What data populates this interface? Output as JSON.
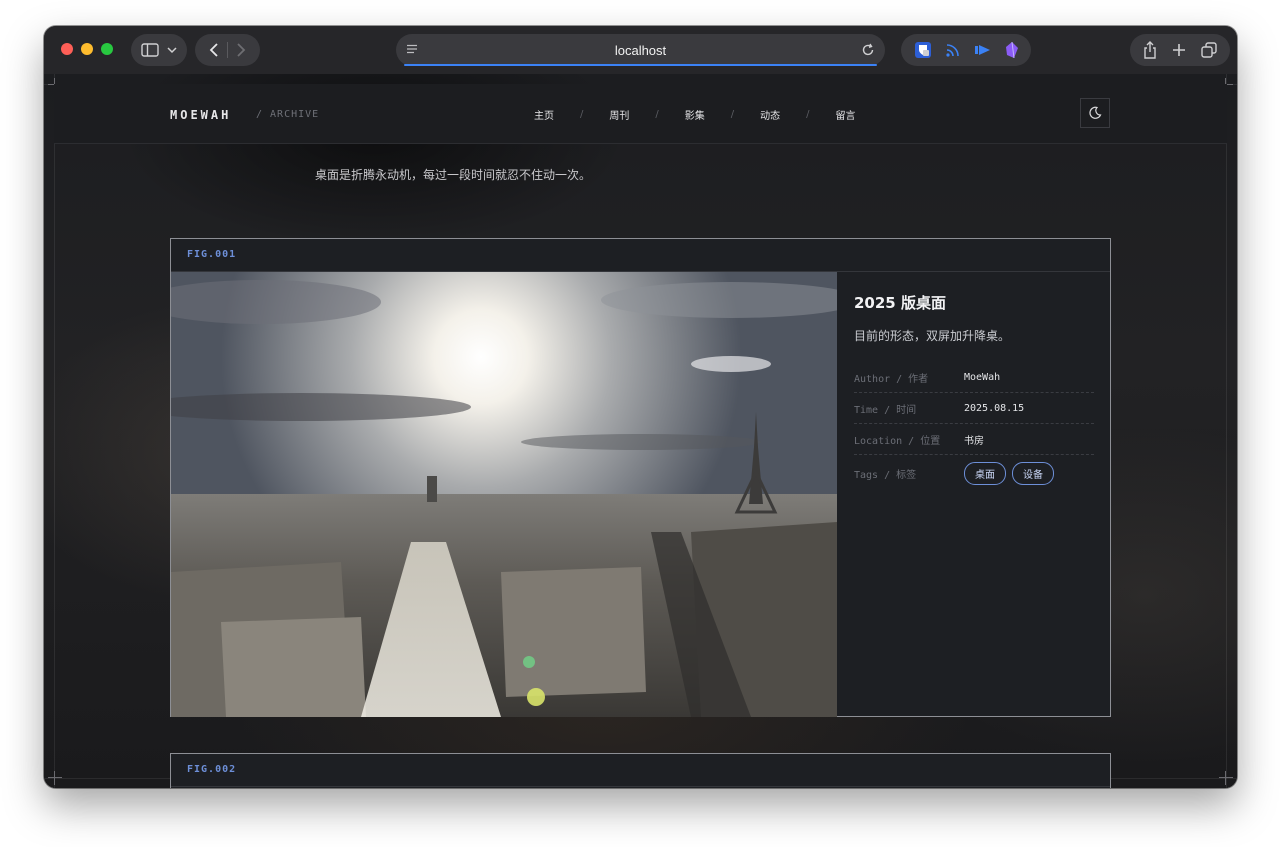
{
  "browser": {
    "url": "localhost",
    "extensions": [
      "bitwarden-icon",
      "rss-icon",
      "play-icon",
      "crystal-icon"
    ]
  },
  "site": {
    "brand": "MOEWAH",
    "brand_sub": "/ ARCHIVE",
    "nav": [
      "主页",
      "周刊",
      "影集",
      "动态",
      "留言"
    ],
    "intro": "桌面是折腾永动机，每过一段时间就忍不住动一次。"
  },
  "cards": [
    {
      "fig": "FIG.001",
      "title": "2025 版桌面",
      "description": "目前的形态，双屏加升降桌。",
      "meta": {
        "author_label": "Author / 作者",
        "author": "MoeWah",
        "time_label": "Time / 时间",
        "time": "2025.08.15",
        "location_label": "Location / 位置",
        "location": "书房",
        "tags_label": "Tags / 标签",
        "tags": [
          "桌面",
          "设备"
        ]
      }
    },
    {
      "fig": "FIG.002"
    }
  ],
  "colors": {
    "accent": "#6d8fd8",
    "toolbar": "#262629",
    "progress": "#3b82f6"
  }
}
